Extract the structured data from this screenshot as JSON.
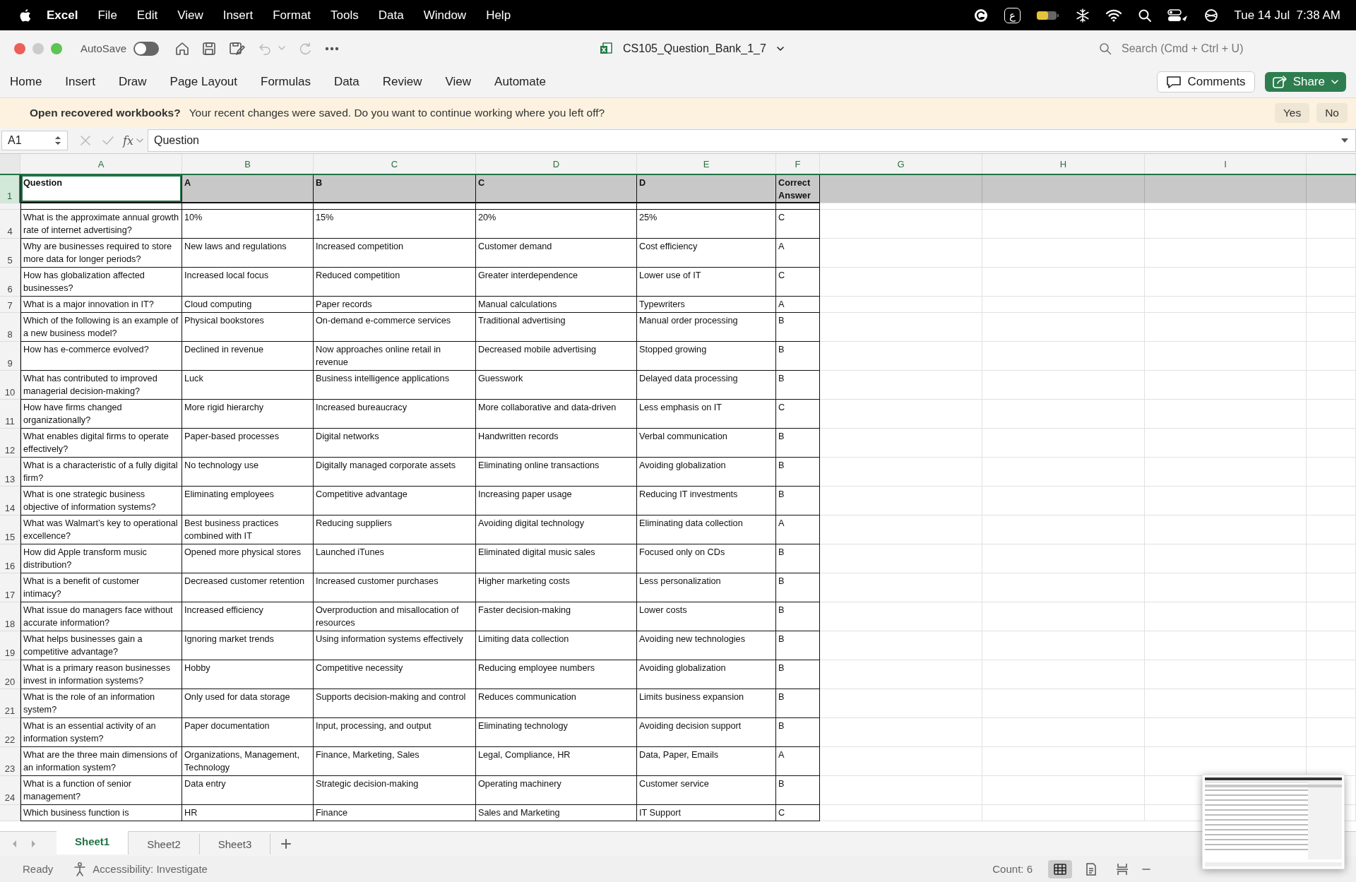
{
  "menu_bar": {
    "app": "Excel",
    "items": [
      "File",
      "Edit",
      "View",
      "Insert",
      "Format",
      "Tools",
      "Data",
      "Window",
      "Help"
    ],
    "input_source": "ع",
    "clock": "Tue 14 Jul  7:38 AM"
  },
  "toolbar": {
    "autosave_label": "AutoSave",
    "autosave_on": false,
    "file_name": "CS105_Question_Bank_1_7",
    "search_placeholder": "Search (Cmd + Ctrl + U)"
  },
  "ribbon": {
    "tabs": [
      "Home",
      "Insert",
      "Draw",
      "Page Layout",
      "Formulas",
      "Data",
      "Review",
      "View",
      "Automate"
    ],
    "comments": "Comments",
    "share": "Share"
  },
  "notification": {
    "title": "Open recovered workbooks?",
    "message": "Your recent changes were saved. Do you want to continue working where you left off?",
    "buttons": [
      "Yes",
      "No"
    ]
  },
  "formula_bar": {
    "name_box": "A1",
    "function_label": "fx",
    "value": "Question"
  },
  "columns": [
    "A",
    "B",
    "C",
    "D",
    "E",
    "F",
    "G",
    "H",
    "I"
  ],
  "rows": [
    {
      "number": "1",
      "selected": true,
      "header": true,
      "cells": [
        "Question",
        "A",
        "B",
        "C",
        "D",
        "Correct Answer"
      ]
    },
    {
      "number": "4",
      "selected": false,
      "cells": [
        "What is the approximate annual growth rate of internet advertising?",
        "10%",
        "15%",
        "20%",
        "25%",
        "C"
      ]
    },
    {
      "number": "5",
      "selected": false,
      "cells": [
        "Why are businesses required to store more data for longer periods?",
        "New laws and regulations",
        "Increased competition",
        "Customer demand",
        "Cost efficiency",
        "A"
      ]
    },
    {
      "number": "6",
      "selected": false,
      "cells": [
        "How has globalization affected businesses?",
        "Increased local focus",
        "Reduced competition",
        "Greater interdependence",
        "Lower use of IT",
        "C"
      ]
    },
    {
      "number": "7",
      "selected": false,
      "cells": [
        "What is a major innovation in IT?",
        "Cloud computing",
        "Paper records",
        "Manual calculations",
        "Typewriters",
        "A"
      ]
    },
    {
      "number": "8",
      "selected": false,
      "cells": [
        "Which of the following is an example of a new business model?",
        "Physical bookstores",
        "On-demand e-commerce services",
        "Traditional advertising",
        "Manual order processing",
        "B"
      ]
    },
    {
      "number": "9",
      "selected": false,
      "cells": [
        "How has e-commerce evolved?",
        "Declined in revenue",
        "Now approaches online retail in revenue",
        "Decreased mobile advertising",
        "Stopped growing",
        "B"
      ]
    },
    {
      "number": "10",
      "selected": false,
      "cells": [
        "What has contributed to improved managerial decision-making?",
        "Luck",
        "Business intelligence applications",
        "Guesswork",
        "Delayed data processing",
        "B"
      ]
    },
    {
      "number": "11",
      "selected": false,
      "cells": [
        "How have firms changed organizationally?",
        "More rigid hierarchy",
        "Increased bureaucracy",
        "More collaborative and data-driven",
        "Less emphasis on IT",
        "C"
      ]
    },
    {
      "number": "12",
      "selected": false,
      "cells": [
        "What enables digital firms to operate effectively?",
        "Paper-based processes",
        "Digital networks",
        "Handwritten records",
        "Verbal communication",
        "B"
      ]
    },
    {
      "number": "13",
      "selected": false,
      "cells": [
        "What is a characteristic of a fully digital firm?",
        "No technology use",
        "Digitally managed corporate assets",
        "Eliminating online transactions",
        "Avoiding globalization",
        "B"
      ]
    },
    {
      "number": "14",
      "selected": false,
      "cells": [
        "What is one strategic business objective of information systems?",
        "Eliminating employees",
        "Competitive advantage",
        "Increasing paper usage",
        "Reducing IT investments",
        "B"
      ]
    },
    {
      "number": "15",
      "selected": false,
      "cells": [
        "What was Walmart’s key to operational excellence?",
        "Best business practices combined with IT",
        "Reducing suppliers",
        "Avoiding digital technology",
        "Eliminating data collection",
        "A"
      ]
    },
    {
      "number": "16",
      "selected": false,
      "cells": [
        "How did Apple transform music distribution?",
        "Opened more physical stores",
        "Launched iTunes",
        "Eliminated digital music sales",
        "Focused only on CDs",
        "B"
      ]
    },
    {
      "number": "17",
      "selected": false,
      "cells": [
        "What is a benefit of customer intimacy?",
        "Decreased customer retention",
        "Increased customer purchases",
        "Higher marketing costs",
        "Less personalization",
        "B"
      ]
    },
    {
      "number": "18",
      "selected": false,
      "cells": [
        "What issue do managers face without accurate information?",
        "Increased efficiency",
        "Overproduction and misallocation of resources",
        "Faster decision-making",
        "Lower costs",
        "B"
      ]
    },
    {
      "number": "19",
      "selected": false,
      "cells": [
        "What helps businesses gain a competitive advantage?",
        "Ignoring market trends",
        "Using information systems effectively",
        "Limiting data collection",
        "Avoiding new technologies",
        "B"
      ]
    },
    {
      "number": "20",
      "selected": false,
      "cells": [
        "What is a primary reason businesses invest in information systems?",
        "Hobby",
        "Competitive necessity",
        "Reducing employee numbers",
        "Avoiding globalization",
        "B"
      ]
    },
    {
      "number": "21",
      "selected": false,
      "cells": [
        "What is the role of an information system?",
        "Only used for data storage",
        "Supports decision-making and control",
        "Reduces communication",
        "Limits business expansion",
        "B"
      ]
    },
    {
      "number": "22",
      "selected": false,
      "cells": [
        "What is an essential activity of an information system?",
        "Paper documentation",
        "Input, processing, and output",
        "Eliminating technology",
        "Avoiding decision support",
        "B"
      ]
    },
    {
      "number": "23",
      "selected": false,
      "cells": [
        "What are the three main dimensions of an information system?",
        "Organizations, Management, Technology",
        "Finance, Marketing, Sales",
        "Legal, Compliance, HR",
        "Data, Paper, Emails",
        "A"
      ]
    },
    {
      "number": "24",
      "selected": false,
      "cells": [
        "What is a function of senior management?",
        "Data entry",
        "Strategic decision-making",
        "Operating machinery",
        "Customer service",
        "B"
      ]
    },
    {
      "selected": false,
      "cells": [
        "Which business function is",
        "HR",
        "Finance",
        "Sales and Marketing",
        "IT Support",
        "C"
      ]
    }
  ],
  "sheet_tabs": [
    {
      "label": "Sheet1",
      "selected": true
    },
    {
      "label": "Sheet2",
      "selected": false
    },
    {
      "label": "Sheet3",
      "selected": false
    }
  ],
  "status_bar": {
    "status": "Ready",
    "accessibility": "Accessibility: Investigate",
    "count": "Count: 6",
    "views": [
      {
        "kind": "normal",
        "selected": true
      },
      {
        "kind": "page-layout",
        "selected": false
      },
      {
        "kind": "page-break",
        "selected": false
      }
    ]
  }
}
